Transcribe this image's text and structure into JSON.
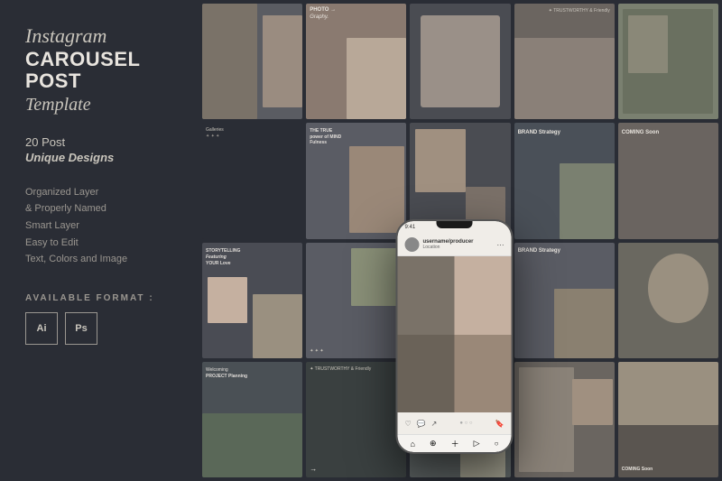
{
  "left": {
    "title_instagram": "Instagram",
    "title_carousel": "CAROUSEL POST",
    "title_template": "Template",
    "post_count": "20 Post",
    "unique_designs": "Unique Designs",
    "features": [
      "Organized Layer",
      "& Properly Named",
      "Smart Layer",
      "Easy to Edit",
      "Text, Colors and Image"
    ],
    "available_format_label": "AVAILABLE FORMAT :",
    "badges": [
      "Ai",
      "Ps"
    ]
  },
  "right": {
    "brand_strategy_label": "BRAND Strategy",
    "coming_soon_label": "COMING Soon",
    "storytelling_label": "STORYTELLING",
    "featuring_label": "Featuring",
    "your_love_label": "YOUR Love",
    "photo_label": "PHOTO →",
    "photography_label": "Graphy.",
    "the_true_label": "THE TRUE",
    "power_mind_label": "power of MIND",
    "fulness_label": "Fulness",
    "welcoming_label": "Welcoming",
    "project_label": "PROJECT Planning",
    "trustworthy_label": "✦ TRUSTWORTHY & Friendly",
    "galleries_label": "Galleries",
    "instagram_username": "username/producer",
    "instagram_location": "Location"
  },
  "colors": {
    "bg": "#2a2d35",
    "text_light": "#e8e4de",
    "text_muted": "#9a9690",
    "accent": "#c9c5bc"
  }
}
